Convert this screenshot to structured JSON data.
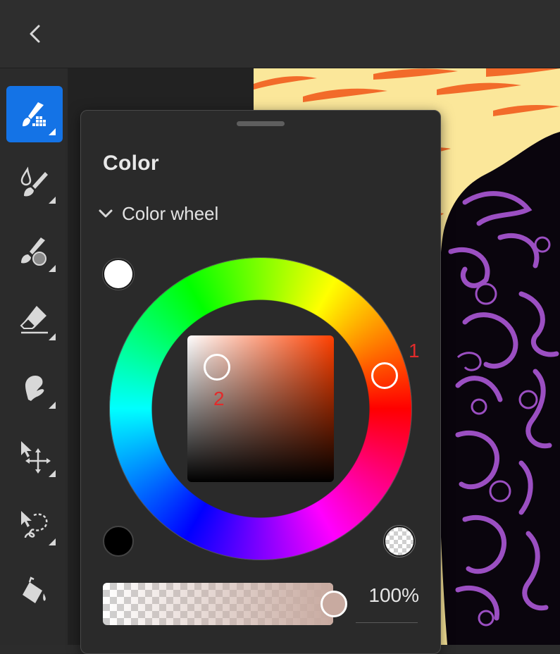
{
  "topbar": {
    "back_icon": "chevron-left-icon"
  },
  "toolbar": {
    "tools": [
      {
        "name": "pixel-brush-tool",
        "icon": "pixel-brush-icon",
        "active": true
      },
      {
        "name": "live-brush-tool",
        "icon": "live-brush-icon"
      },
      {
        "name": "mixer-brush-tool",
        "icon": "mixer-brush-icon"
      },
      {
        "name": "eraser-tool",
        "icon": "eraser-icon"
      },
      {
        "name": "smudge-tool",
        "icon": "smudge-icon"
      },
      {
        "name": "transform-tool",
        "icon": "move-transform-icon"
      },
      {
        "name": "lasso-tool",
        "icon": "lasso-icon"
      },
      {
        "name": "fill-tool",
        "icon": "paint-bucket-icon"
      }
    ]
  },
  "color_panel": {
    "title": "Color",
    "section_label": "Color wheel",
    "primary_swatch": "#ffffff",
    "black_swatch": "#000000",
    "transparent_swatch": "transparent",
    "hue_color": "#ff4000",
    "selected_color": "#c8aaa0",
    "opacity_label": "100%",
    "opacity": 1.0,
    "annotations": {
      "hue_marker": "1",
      "color_marker": "2"
    }
  },
  "colors": {
    "accent": "#1473e6",
    "canvas_bg": "#fbe79a",
    "stripes": "#f26b2a",
    "ink": "#0a050d",
    "purple": "#9b4fc2"
  }
}
